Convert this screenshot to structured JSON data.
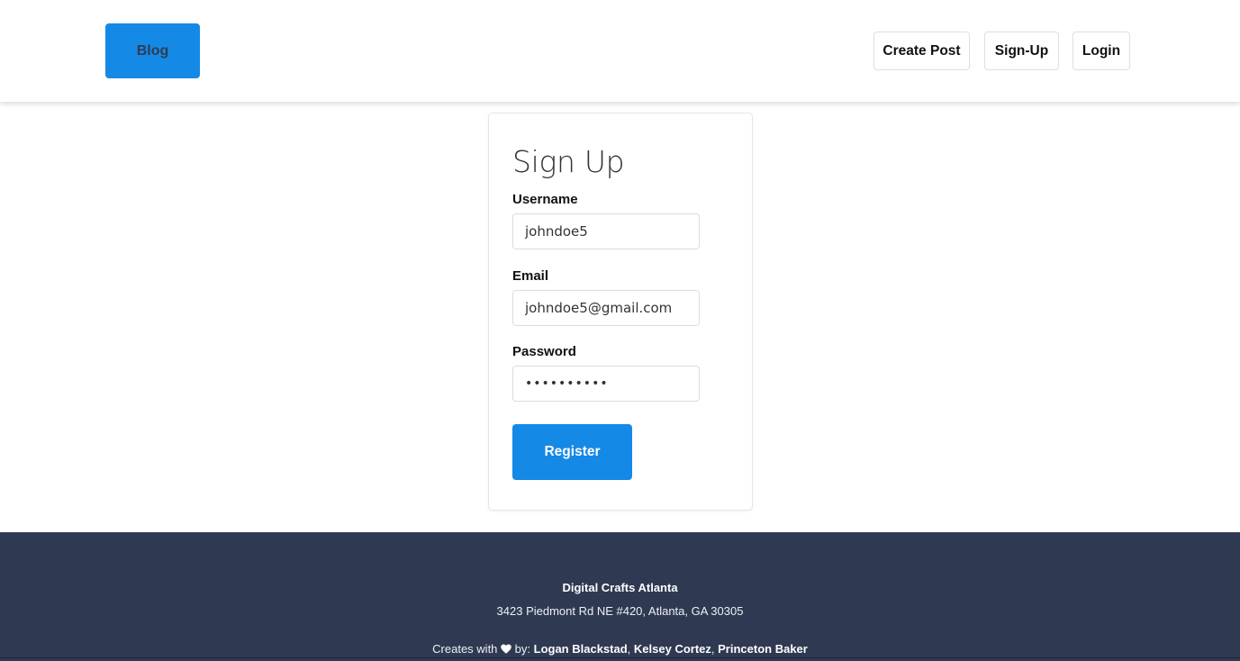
{
  "header": {
    "brand": "Blog",
    "nav": {
      "create_post": "Create Post",
      "sign_up": "Sign-Up",
      "login": "Login"
    }
  },
  "signup_form": {
    "title": "Sign Up",
    "username": {
      "label": "Username",
      "value": "johndoe5"
    },
    "email": {
      "label": "Email",
      "value": "johndoe5@gmail.com"
    },
    "password": {
      "label": "Password",
      "value": "••••••••••"
    },
    "submit_label": "Register"
  },
  "footer": {
    "org": "Digital Crafts Atlanta",
    "address": "3423 Piedmont Rd NE #420, Atlanta, GA 30305",
    "credits_prefix": "Creates with",
    "credits_by": "by:",
    "authors": [
      "Logan Blackstad",
      "Kelsey Cortez",
      "Princeton Baker"
    ],
    "separator": ","
  },
  "colors": {
    "accent": "#1589e6",
    "footer_bg": "#2f3a52"
  },
  "icons": {
    "credits_icon": "heart-icon"
  }
}
